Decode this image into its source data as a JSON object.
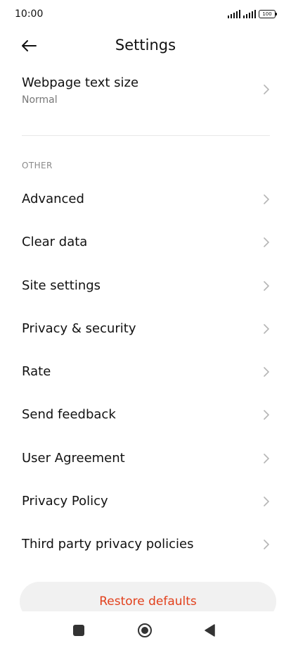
{
  "status_bar": {
    "time": "10:00",
    "battery": "100"
  },
  "header": {
    "title": "Settings"
  },
  "text_size": {
    "label": "Webpage text size",
    "value": "Normal"
  },
  "section": {
    "header": "OTHER"
  },
  "items": [
    {
      "label": "Advanced"
    },
    {
      "label": "Clear data"
    },
    {
      "label": "Site settings"
    },
    {
      "label": "Privacy & security"
    },
    {
      "label": "Rate"
    },
    {
      "label": "Send feedback"
    },
    {
      "label": "User Agreement"
    },
    {
      "label": "Privacy Policy"
    },
    {
      "label": "Third party privacy policies"
    }
  ],
  "restore": {
    "label": "Restore defaults"
  },
  "colors": {
    "accent": "#e2401c",
    "chevron": "#b5b5b5",
    "secondary_text": "#777777"
  },
  "icons": {
    "back": "arrow-left-icon",
    "chevron": "chevron-right-icon",
    "nav_recents": "square-icon",
    "nav_home": "circle-icon",
    "nav_back": "triangle-left-icon"
  }
}
